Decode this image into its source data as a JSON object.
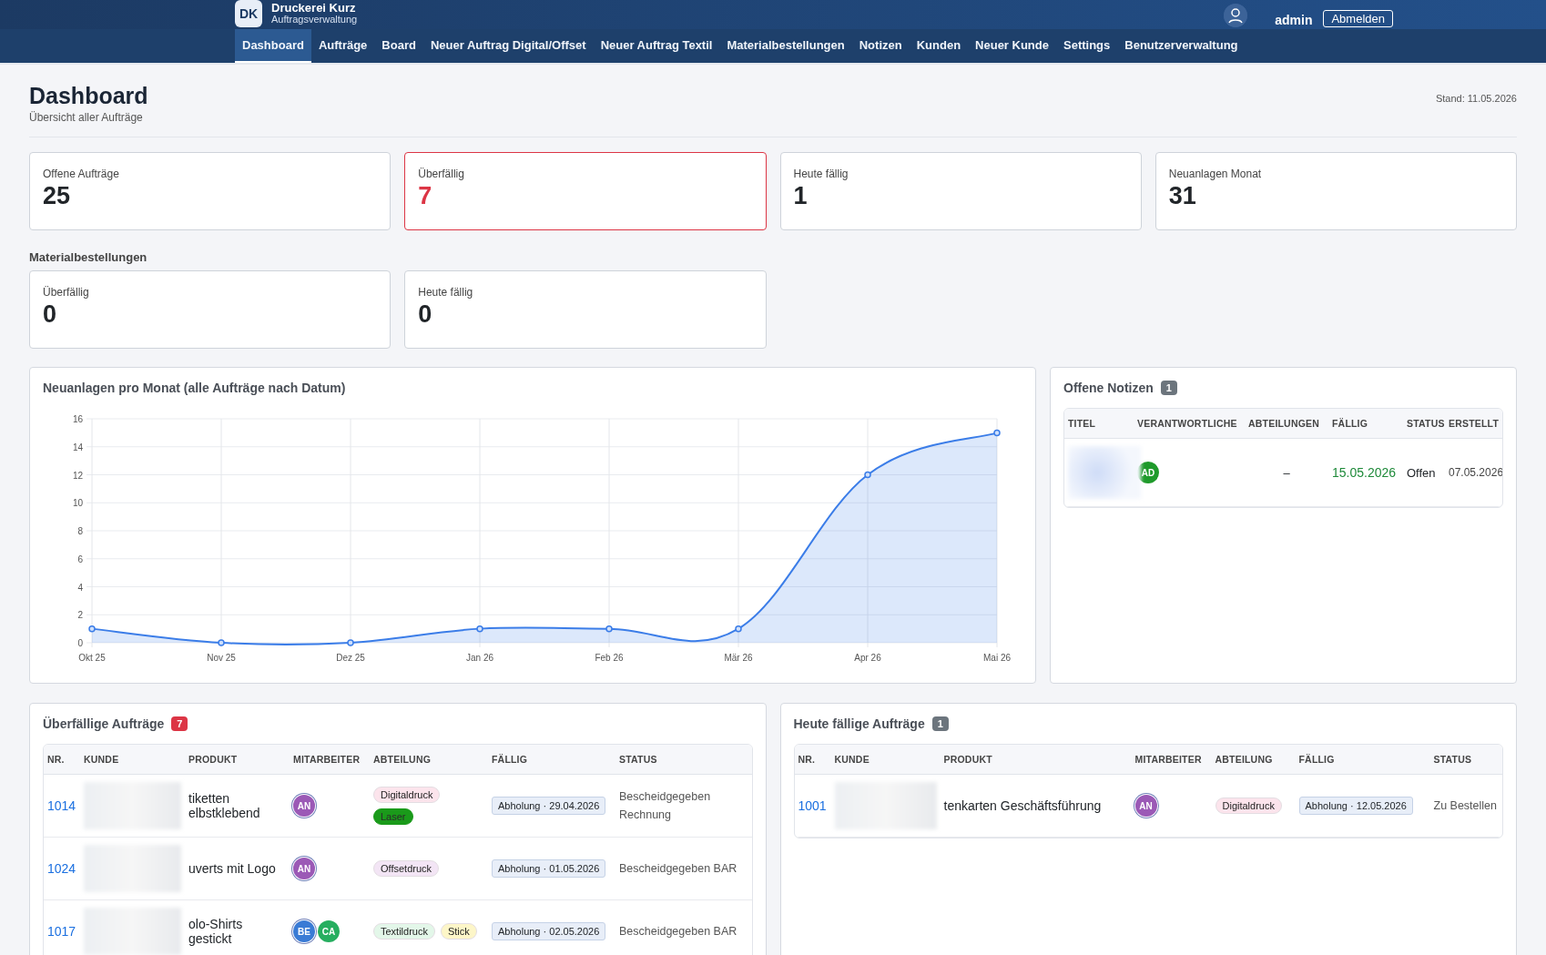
{
  "header": {
    "logo": "DK",
    "brand": "Druckerei Kurz",
    "subtitle": "Auftragsverwaltung",
    "user": "admin",
    "logout": "Abmelden"
  },
  "nav": [
    {
      "label": "Dashboard",
      "selected": true
    },
    {
      "label": "Aufträge",
      "selected": false
    },
    {
      "label": "Board",
      "selected": false
    },
    {
      "label": "Neuer Auftrag Digital/Offset",
      "selected": false
    },
    {
      "label": "Neuer Auftrag Textil",
      "selected": false
    },
    {
      "label": "Materialbestellungen",
      "selected": false
    },
    {
      "label": "Notizen",
      "selected": false
    },
    {
      "label": "Kunden",
      "selected": false
    },
    {
      "label": "Neuer Kunde",
      "selected": false
    },
    {
      "label": "Settings",
      "selected": false
    },
    {
      "label": "Benutzerverwaltung",
      "selected": false
    }
  ],
  "page": {
    "title": "Dashboard",
    "subtitle": "Übersicht aller Aufträge",
    "stand": "Stand: 11.05.2026"
  },
  "stats": [
    {
      "label": "Offene Aufträge",
      "value": "25",
      "alert": false
    },
    {
      "label": "Überfällig",
      "value": "7",
      "alert": true
    },
    {
      "label": "Heute fällig",
      "value": "1",
      "alert": false
    },
    {
      "label": "Neuanlagen Monat",
      "value": "31",
      "alert": false
    }
  ],
  "material": {
    "heading": "Materialbestellungen",
    "stats": [
      {
        "label": "Überfällig",
        "value": "0",
        "alert": false
      },
      {
        "label": "Heute fällig",
        "value": "0",
        "alert": false
      }
    ]
  },
  "chart_card": {
    "title": "Neuanlagen pro Monat (alle Aufträge nach Datum)",
    "chart_data": {
      "type": "area",
      "categories": [
        "Okt 25",
        "Nov 25",
        "Dez 25",
        "Jan 26",
        "Feb 26",
        "Mär 26",
        "Apr 26",
        "Mai 26"
      ],
      "grid": true,
      "series": [
        {
          "color": "#3b7de8",
          "values": [
            1,
            0,
            0,
            1,
            1,
            1,
            12,
            15
          ]
        }
      ],
      "ylim": [
        0,
        16
      ],
      "yticks": [
        0,
        2,
        4,
        6,
        8,
        10,
        12,
        14,
        16
      ]
    }
  },
  "notes": {
    "title": "Offene Notizen",
    "count": "1",
    "columns": [
      "TITEL",
      "VERANTWORTLICHE",
      "ABTEILUNGEN",
      "FÄLLIG",
      "STATUS",
      "ERSTELLT"
    ],
    "rows": [
      {
        "owner": {
          "initials": "AD",
          "color": "#1f9a2b"
        },
        "abteilungen": "–",
        "faellig": "15.05.2026",
        "status": "Offen",
        "erstellt": "07.05.2026"
      }
    ]
  },
  "overdue": {
    "title": "Überfällige Aufträge",
    "count": "7",
    "alert": true,
    "columns": [
      "NR.",
      "KUNDE",
      "PRODUKT",
      "MITARBEITER",
      "ABTEILUNG",
      "FÄLLIG",
      "STATUS"
    ],
    "rows": [
      {
        "nr": "1014",
        "produkt": "tiketten elbstklebend",
        "staff": [
          {
            "initials": "AN",
            "color": "#9b59b6"
          }
        ],
        "tags": [
          {
            "label": "Digitaldruck",
            "color": "#fce4ec"
          },
          {
            "label": "Laser",
            "color": "#1a9a1a"
          }
        ],
        "faellig": "Abholung · 29.04.2026",
        "status": "Bescheidgegeben Rechnung"
      },
      {
        "nr": "1024",
        "produkt": "uverts mit Logo",
        "staff": [
          {
            "initials": "AN",
            "color": "#9b59b6"
          }
        ],
        "tags": [
          {
            "label": "Offsetdruck",
            "color": "#f3e5f5"
          }
        ],
        "faellig": "Abholung · 01.05.2026",
        "status": "Bescheidgegeben BAR"
      },
      {
        "nr": "1017",
        "produkt": "olo-Shirts gestickt",
        "staff": [
          {
            "initials": "BE",
            "color": "#3a7bd5"
          },
          {
            "initials": "CA",
            "color": "#27ae60"
          }
        ],
        "tags": [
          {
            "label": "Textildruck",
            "color": "#e3f7e9"
          },
          {
            "label": "Stick",
            "color": "#fdf6c8"
          }
        ],
        "faellig": "Abholung · 02.05.2026",
        "status": "Bescheidgegeben BAR"
      }
    ]
  },
  "today": {
    "title": "Heute fällige Aufträge",
    "count": "1",
    "alert": false,
    "columns": [
      "NR.",
      "KUNDE",
      "PRODUKT",
      "MITARBEITER",
      "ABTEILUNG",
      "FÄLLIG",
      "STATUS"
    ],
    "rows": [
      {
        "nr": "1001",
        "produkt": "tenkarten Geschäftsführung",
        "staff": [
          {
            "initials": "AN",
            "color": "#9b59b6"
          }
        ],
        "tags": [
          {
            "label": "Digitaldruck",
            "color": "#fce4ec"
          }
        ],
        "faellig": "Abholung · 12.05.2026",
        "status": "Zu Bestellen"
      }
    ]
  }
}
